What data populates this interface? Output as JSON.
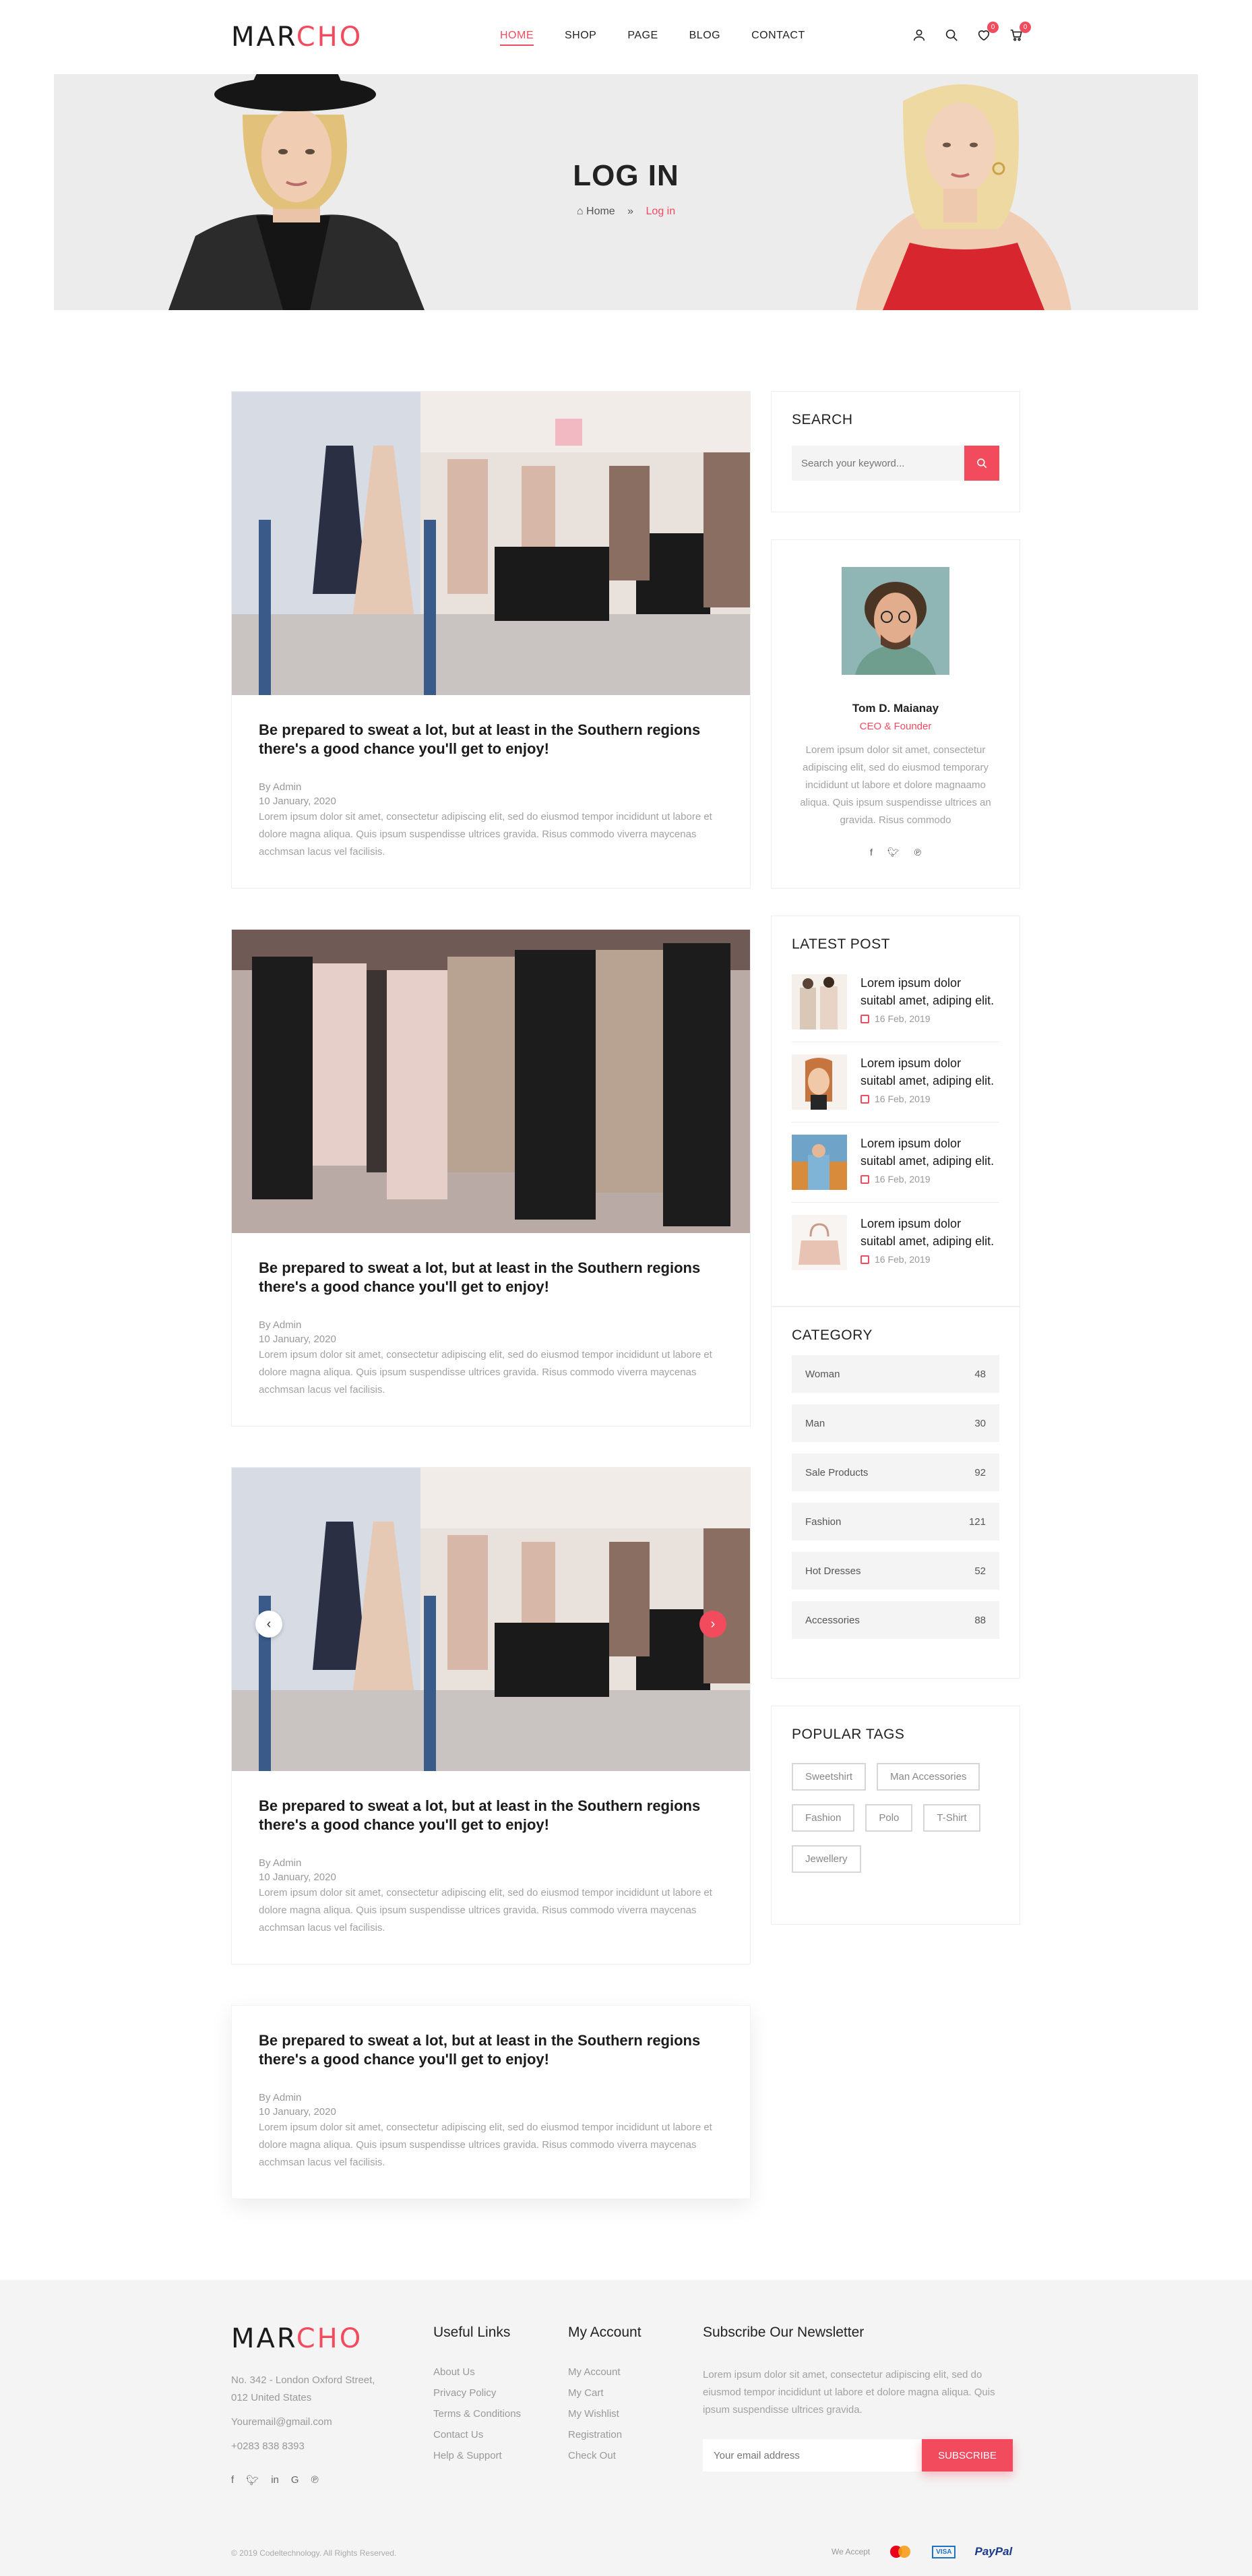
{
  "header": {
    "logo_part1": "MAR",
    "logo_part2": "CHO",
    "nav": [
      "HOME",
      "SHOP",
      "PAGE",
      "BLOG",
      "CONTACT"
    ],
    "wishlist_count": "0",
    "cart_count": "0"
  },
  "hero": {
    "title": "LOG IN",
    "breadcrumb_home": "Home",
    "breadcrumb_separator": "»",
    "breadcrumb_current": "Log in"
  },
  "posts": [
    {
      "title": "Be prepared to sweat a lot, but at least in the Southern regions there's a good chance you'll get to enjoy!",
      "author": "By Admin",
      "date": "10 January, 2020",
      "excerpt": "Lorem ipsum dolor sit amet, consectetur adipiscing elit, sed do eiusmod tempor incididunt ut labore et dolore magna aliqua. Quis ipsum suspendisse ultrices gravida. Risus commodo viverra maycenas acchmsan lacus vel facilisis."
    },
    {
      "title": "Be prepared to sweat a lot, but at least in the Southern regions there's a good chance you'll get to enjoy!",
      "author": "By Admin",
      "date": "10 January, 2020",
      "excerpt": "Lorem ipsum dolor sit amet, consectetur adipiscing elit, sed do eiusmod tempor incididunt ut labore et dolore magna aliqua. Quis ipsum suspendisse ultrices gravida. Risus commodo viverra maycenas acchmsan lacus vel facilisis."
    },
    {
      "title": "Be prepared to sweat a lot, but at least in the Southern regions there's a good chance you'll get to enjoy!",
      "author": "By Admin",
      "date": "10 January, 2020",
      "excerpt": "Lorem ipsum dolor sit amet, consectetur adipiscing elit, sed do eiusmod tempor incididunt ut labore et dolore magna aliqua. Quis ipsum suspendisse ultrices gravida. Risus commodo viverra maycenas acchmsan lacus vel facilisis."
    },
    {
      "title": "Be prepared to sweat a lot, but at least in the Southern regions there's a good chance you'll get to enjoy!",
      "author": "By Admin",
      "date": "10 January, 2020",
      "excerpt": "Lorem ipsum dolor sit amet, consectetur adipiscing elit, sed do eiusmod tempor incididunt ut labore et dolore magna aliqua. Quis ipsum suspendisse ultrices gravida. Risus commodo viverra maycenas acchmsan lacus vel facilisis."
    }
  ],
  "sidebar": {
    "search_title": "SEARCH",
    "search_placeholder": "Search your keyword...",
    "author_name": "Tom D. Maianay",
    "author_role": "CEO & Founder",
    "author_bio": "Lorem ipsum dolor sit amet, consectetur adipiscing elit, sed do eiusmod temporary incididunt ut labore et dolore magnaamo aliqua. Quis ipsum suspendisse ultrices an gravida. Risus commodo",
    "latest_title": "LATEST POST",
    "latest_posts": [
      {
        "title": "Lorem ipsum dolor suitabl amet, adiping elit.",
        "date": "16 Feb, 2019"
      },
      {
        "title": "Lorem ipsum dolor suitabl amet, adiping elit.",
        "date": "16 Feb, 2019"
      },
      {
        "title": "Lorem ipsum dolor suitabl amet, adiping elit.",
        "date": "16 Feb, 2019"
      },
      {
        "title": "Lorem ipsum dolor suitabl amet, adiping elit.",
        "date": "16 Feb, 2019"
      }
    ],
    "category_title": "CATEGORY",
    "categories": [
      {
        "name": "Woman",
        "count": "48"
      },
      {
        "name": "Man",
        "count": "30"
      },
      {
        "name": "Sale Products",
        "count": "92"
      },
      {
        "name": "Fashion",
        "count": "121"
      },
      {
        "name": "Hot Dresses",
        "count": "52"
      },
      {
        "name": "Accessories",
        "count": "88"
      }
    ],
    "tags_title": "POPULAR TAGS",
    "tags": [
      "Sweetshirt",
      "Man Accessories",
      "Fashion",
      "Polo",
      "T-Shirt",
      "Jewellery"
    ]
  },
  "footer": {
    "logo_part1": "MAR",
    "logo_part2": "CHO",
    "address_line1": "No. 342 - London Oxford Street,",
    "address_line2": "012 United States",
    "email": "Youremail@gmail.com",
    "phone": "+0283 838 8393",
    "useful_title": "Useful Links",
    "useful_links": [
      "About Us",
      "Privacy Policy",
      "Terms & Conditions",
      "Contact Us",
      "Help & Support"
    ],
    "account_title": "My Account",
    "account_links": [
      "My Account",
      "My Cart",
      "My Wishlist",
      "Registration",
      "Check Out"
    ],
    "newsletter_title": "Subscribe Our Newsletter",
    "newsletter_text": "Lorem ipsum dolor sit amet, consectetur adipiscing elit, sed do eiusmod tempor incididunt ut labore et dolore magna aliqua. Quis ipsum suspendisse ultrices gravida.",
    "email_placeholder": "Your email address",
    "subscribe_label": "SUBSCRIBE",
    "copyright": "© 2019 Codeltechnology. All Rights Reserved.",
    "we_accept": "We Accept",
    "paypal": "PayPal",
    "visa": "VISA"
  },
  "colors": {
    "accent": "#f24b5e",
    "hero_bg": "#ececec",
    "footer_bg": "#f4f4f4"
  }
}
